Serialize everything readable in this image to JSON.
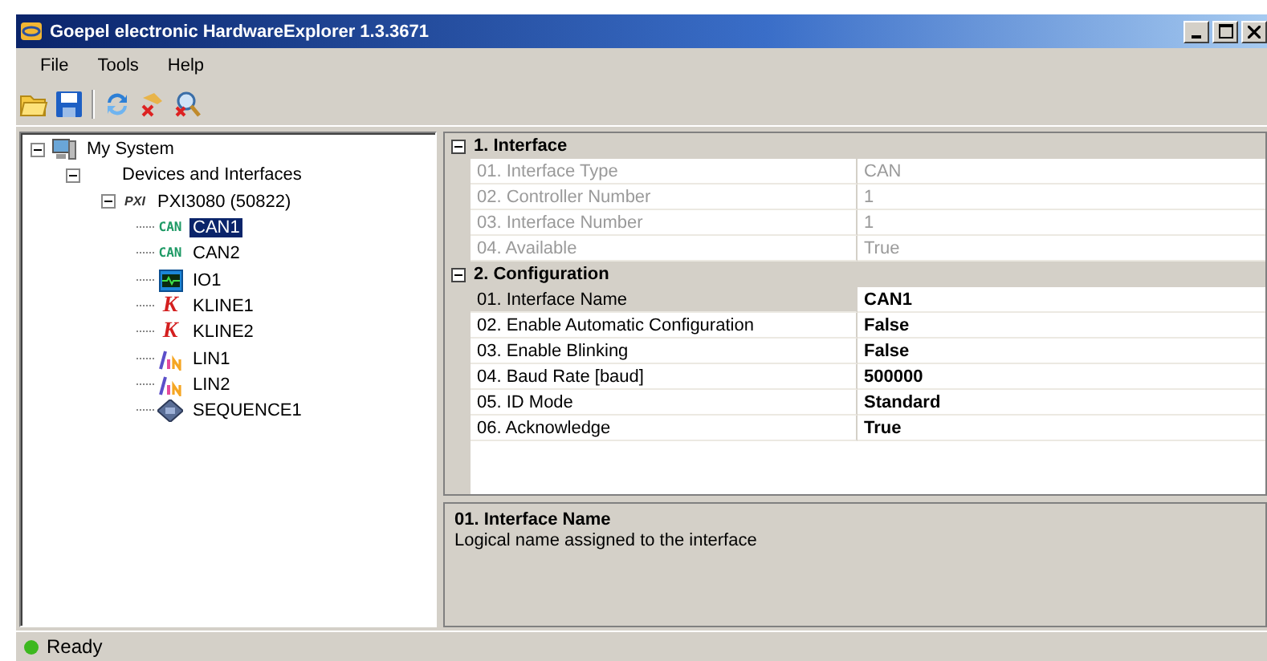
{
  "window": {
    "title": "Goepel electronic HardwareExplorer 1.3.3671"
  },
  "menu": [
    "File",
    "Tools",
    "Help"
  ],
  "toolbar": [
    {
      "kind": "open"
    },
    {
      "kind": "save"
    },
    {
      "kind": "refresh"
    },
    {
      "kind": "tool-remove"
    },
    {
      "kind": "search-remove"
    }
  ],
  "tree": [
    {
      "label": "My System",
      "kind": "computer",
      "expanded": true,
      "selected": false,
      "children": [
        {
          "label": "Devices and Interfaces",
          "expanded": true,
          "selected": false,
          "children": [
            {
              "label": "PXI3080 (50822)",
              "kind": "pxi",
              "badge": "PXI",
              "expanded": true,
              "selected": false,
              "children": [
                {
                  "label": "CAN1",
                  "kind": "can",
                  "badge": "CAN",
                  "selected": true
                },
                {
                  "label": "CAN2",
                  "kind": "can",
                  "badge": "CAN",
                  "selected": false
                },
                {
                  "label": "IO1",
                  "kind": "io",
                  "selected": false
                },
                {
                  "label": "KLINE1",
                  "kind": "kline",
                  "badge": "K",
                  "selected": false
                },
                {
                  "label": "KLINE2",
                  "kind": "kline",
                  "badge": "K",
                  "selected": false
                },
                {
                  "label": "LIN1",
                  "kind": "lin",
                  "selected": false
                },
                {
                  "label": "LIN2",
                  "kind": "lin",
                  "selected": false
                },
                {
                  "label": "SEQUENCE1",
                  "kind": "sequence",
                  "selected": false
                }
              ]
            }
          ]
        }
      ]
    }
  ],
  "properties": [
    {
      "category": "1. Interface",
      "expanded": true,
      "rows": [
        {
          "name": "01. Interface Type",
          "value": "CAN",
          "disabled": true,
          "selected": false
        },
        {
          "name": "02. Controller Number",
          "value": "1",
          "disabled": true,
          "selected": false
        },
        {
          "name": "03. Interface Number",
          "value": "1",
          "disabled": true,
          "selected": false
        },
        {
          "name": "04. Available",
          "value": "True",
          "disabled": true,
          "selected": false
        }
      ]
    },
    {
      "category": "2. Configuration",
      "expanded": true,
      "rows": [
        {
          "name": "01. Interface Name",
          "value": "CAN1",
          "disabled": false,
          "selected": true
        },
        {
          "name": "02. Enable Automatic Configuration",
          "value": "False",
          "disabled": false,
          "selected": false
        },
        {
          "name": "03. Enable Blinking",
          "value": "False",
          "disabled": false,
          "selected": false
        },
        {
          "name": "04. Baud Rate [baud]",
          "value": "500000",
          "disabled": false,
          "selected": false
        },
        {
          "name": "05. ID Mode",
          "value": "Standard",
          "disabled": false,
          "selected": false
        },
        {
          "name": "06. Acknowledge",
          "value": "True",
          "disabled": false,
          "selected": false
        }
      ]
    }
  ],
  "help": {
    "title": "01. Interface Name",
    "text": "Logical name assigned to the interface"
  },
  "status_bar": {
    "text": "Ready",
    "color": "#3cb81f"
  }
}
